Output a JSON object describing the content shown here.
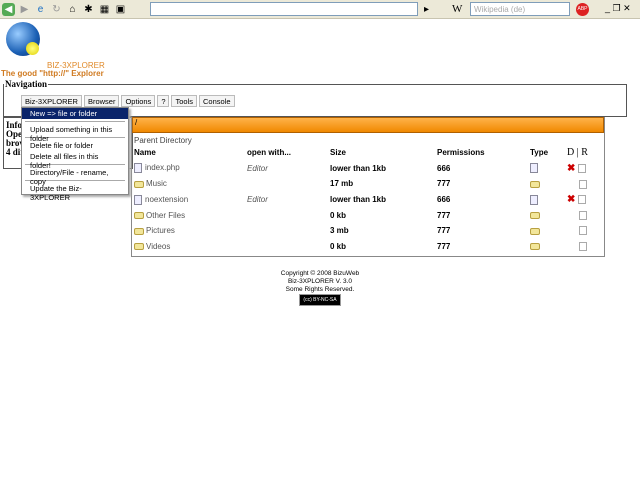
{
  "browser": {
    "search_placeholder": "Wikipedia (de)",
    "search_engine": "W"
  },
  "app": {
    "brand": "BIZ-3XPLORER",
    "tagline": "The good \"http://\" Explorer"
  },
  "navigation": {
    "legend": "Navigation",
    "menu": [
      "Biz-3XPLORER",
      "Browser",
      "Options",
      "?",
      "Tools",
      "Console"
    ],
    "dropdown": [
      [
        "New => file or folder"
      ],
      [
        "Upload something in this folder"
      ],
      [
        "Delete file or folder",
        "Delete all files in this folder!"
      ],
      [
        "Directory/File - rename, copy"
      ],
      [
        "Update the Biz-3XPLORER"
      ]
    ]
  },
  "info": {
    "legend": "Info",
    "lines": [
      "Ope",
      "brov",
      "4 dir"
    ]
  },
  "files": {
    "path": "/",
    "parent": "Parent Directory",
    "headers": [
      "Name",
      "open with...",
      "Size",
      "Permissions",
      "Type",
      "D | R"
    ],
    "rows": [
      {
        "name": "index.php",
        "open": "Editor",
        "size": "lower than 1kb",
        "perm": "666",
        "kind": "file",
        "del": true
      },
      {
        "name": "Music",
        "open": "",
        "size": "17 mb",
        "perm": "777",
        "kind": "folder",
        "del": false
      },
      {
        "name": "noextension",
        "open": "Editor",
        "size": "lower than 1kb",
        "perm": "666",
        "kind": "file",
        "del": true
      },
      {
        "name": "Other Files",
        "open": "",
        "size": "0 kb",
        "perm": "777",
        "kind": "folder",
        "del": false
      },
      {
        "name": "Pictures",
        "open": "",
        "size": "3 mb",
        "perm": "777",
        "kind": "folder",
        "del": false
      },
      {
        "name": "Videos",
        "open": "",
        "size": "0 kb",
        "perm": "777",
        "kind": "folder",
        "del": false
      }
    ]
  },
  "footer": {
    "lines": [
      "Copyright © 2008 BizuWeb",
      "Biz-3XPLORER V. 3.0",
      "Some Rights Reserved."
    ],
    "badge": "BY-NC-SA"
  }
}
